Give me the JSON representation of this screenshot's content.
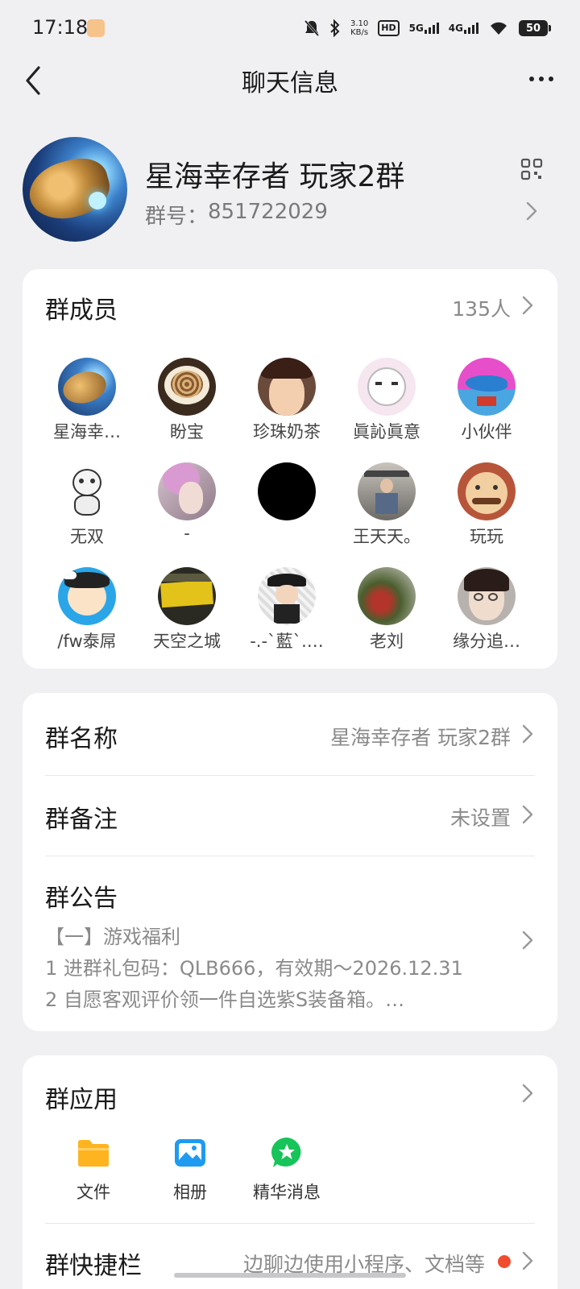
{
  "status_bar": {
    "time": "17:18",
    "speed_top": "3.10",
    "speed_unit": "KB/s",
    "hd_label": "HD",
    "net1": "5G",
    "net2": "4G",
    "battery": "50"
  },
  "nav": {
    "title": "聊天信息"
  },
  "group": {
    "name": "星海幸存者 玩家2群",
    "id_label": "群号：",
    "id_value": "851722029"
  },
  "members": {
    "title": "群成员",
    "count": "135人",
    "items": [
      {
        "name": "星海幸…",
        "avatar": "starship"
      },
      {
        "name": "盼宝",
        "avatar": "coffee"
      },
      {
        "name": "珍珠奶茶",
        "avatar": "anime-boy"
      },
      {
        "name": "眞訫眞意",
        "avatar": "meme-face"
      },
      {
        "name": "小伙伴",
        "avatar": "shark"
      },
      {
        "name": "无双",
        "avatar": "panda"
      },
      {
        "name": "-",
        "avatar": "pink-hair"
      },
      {
        "name": "",
        "avatar": "black"
      },
      {
        "name": "王天天。",
        "avatar": "gym"
      },
      {
        "name": "玩玩",
        "avatar": "mustache"
      },
      {
        "name": "/fw泰屌",
        "avatar": "cartoon"
      },
      {
        "name": "天空之城",
        "avatar": "yellow-text"
      },
      {
        "name": "‐.‐`藍`.…",
        "avatar": "hat-boy"
      },
      {
        "name": "老刘",
        "avatar": "flowers"
      },
      {
        "name": "缘分追…",
        "avatar": "girl"
      }
    ]
  },
  "info": {
    "group_name_label": "群名称",
    "group_name_value": "星海幸存者 玩家2群",
    "remark_label": "群备注",
    "remark_value": "未设置",
    "notice_label": "群公告",
    "notice_line1": "【一】游戏福利",
    "notice_line2": "1 进群礼包码：QLB666，有效期～2026.12.31",
    "notice_line3": "2 自愿客观评价领一件自选紫S装备箱。…"
  },
  "apps": {
    "title": "群应用",
    "items": [
      {
        "label": "文件",
        "icon": "folder-icon",
        "color": "#ffb31f"
      },
      {
        "label": "相册",
        "icon": "album-icon",
        "color": "#1e9bf0"
      },
      {
        "label": "精华消息",
        "icon": "star-chat-icon",
        "color": "#16c45a"
      }
    ],
    "shortcut_label": "群快捷栏",
    "shortcut_value": "边聊边使用小程序、文档等"
  }
}
